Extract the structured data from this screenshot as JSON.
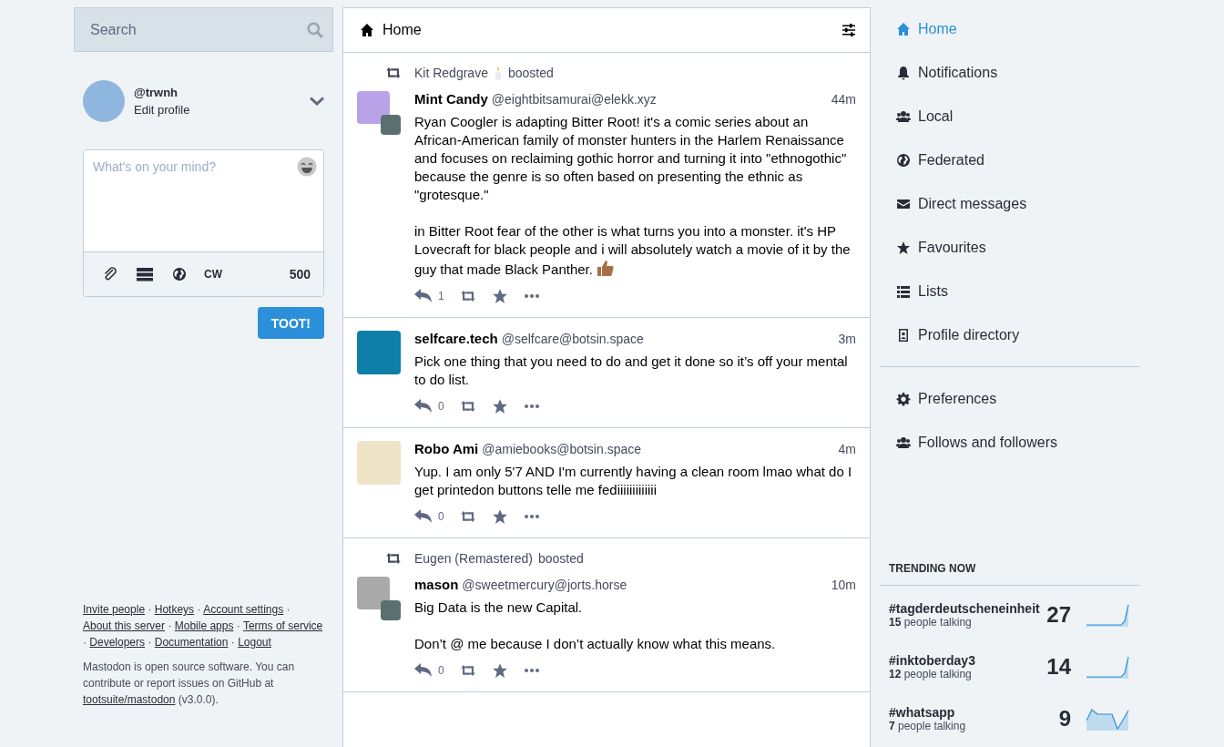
{
  "search": {
    "placeholder": "Search"
  },
  "account": {
    "handle": "@trwnh",
    "edit_link": "Edit profile"
  },
  "compose": {
    "placeholder": "What's on your mind?",
    "cw_label": "CW",
    "char_count": "500",
    "submit": "TOOT!"
  },
  "footer": {
    "separator": "·",
    "links": [
      "Invite people",
      "Hotkeys",
      "Account settings",
      "About this server",
      "Mobile apps",
      "Terms of service",
      "Developers",
      "Documentation",
      "Logout"
    ],
    "about_text": "Mastodon is open source software. You can contribute or report issues on GitHub at",
    "about_link": "tootsuite/mastodon",
    "about_version": "(v3.0.0)."
  },
  "column": {
    "title": "Home"
  },
  "statuses": [
    {
      "boost": {
        "name": "Kit Redgrave",
        "name_emoji": true,
        "label": "boosted"
      },
      "author": "Mint Candy",
      "handle": "@eightbitsamurai@elekk.xyz",
      "time": "44m",
      "paragraphs": [
        "Ryan Coogler is adapting Bitter Root! it's a comic series about an African-American family of monster hunters in the Harlem Renaissance and focuses on reclaiming gothic horror and turning it into \"ethnogothic\" because the genre is so often based on presenting the ethnic as \"grotesque.\"",
        "in Bitter Root fear of the other is what turns you into a monster. it's HP Lovecraft for black people and i will absolutely watch a movie of it by the guy that made Black Panther."
      ],
      "trailing_emoji": true,
      "replies": "1"
    },
    {
      "author": "selfcare.tech",
      "handle": "@selfcare@botsin.space",
      "time": "3m",
      "paragraphs": [
        "Pick one thing that you need to do and get it done so it’s off your mental to do list."
      ],
      "trailing_emoji": false,
      "replies": "0"
    },
    {
      "author": "Robo Ami",
      "handle": "@amiebooks@botsin.space",
      "time": "4m",
      "paragraphs": [
        "Yup. I am only 5'7 AND I'm currently having a clean room lmao what do I get printedon buttons telle me fediiiiiiiiiiiii"
      ],
      "trailing_emoji": false,
      "replies": "0"
    },
    {
      "boost": {
        "name": "Eugen (Remastered)",
        "name_emoji": false,
        "label": "boosted"
      },
      "author": "mason",
      "handle": "@sweetmercury@jorts.horse",
      "time": "10m",
      "paragraphs": [
        "Big Data is the new Capital.",
        "Don’t @ me because I don’t actually know what this means."
      ],
      "trailing_emoji": false,
      "replies": "0"
    }
  ],
  "nav": [
    {
      "label": "Home",
      "selected": true
    },
    {
      "label": "Notifications",
      "selected": false
    },
    {
      "label": "Local",
      "selected": false
    },
    {
      "label": "Federated",
      "selected": false
    },
    {
      "label": "Direct messages",
      "selected": false
    },
    {
      "label": "Favourites",
      "selected": false
    },
    {
      "label": "Lists",
      "selected": false
    },
    {
      "label": "Profile directory",
      "selected": false
    }
  ],
  "nav_secondary": [
    {
      "label": "Preferences"
    },
    {
      "label": "Follows and followers"
    }
  ],
  "trending": {
    "title": "TRENDING NOW",
    "tags": [
      {
        "tag": "#tagderdeutscheneinheit",
        "talking": "**15** people talking",
        "uses": "27"
      },
      {
        "tag": "#inktoberday3",
        "talking": "**12** people talking",
        "uses": "14"
      },
      {
        "tag": "#whatsapp",
        "talking": "**7** people talking",
        "uses": "9"
      }
    ]
  }
}
